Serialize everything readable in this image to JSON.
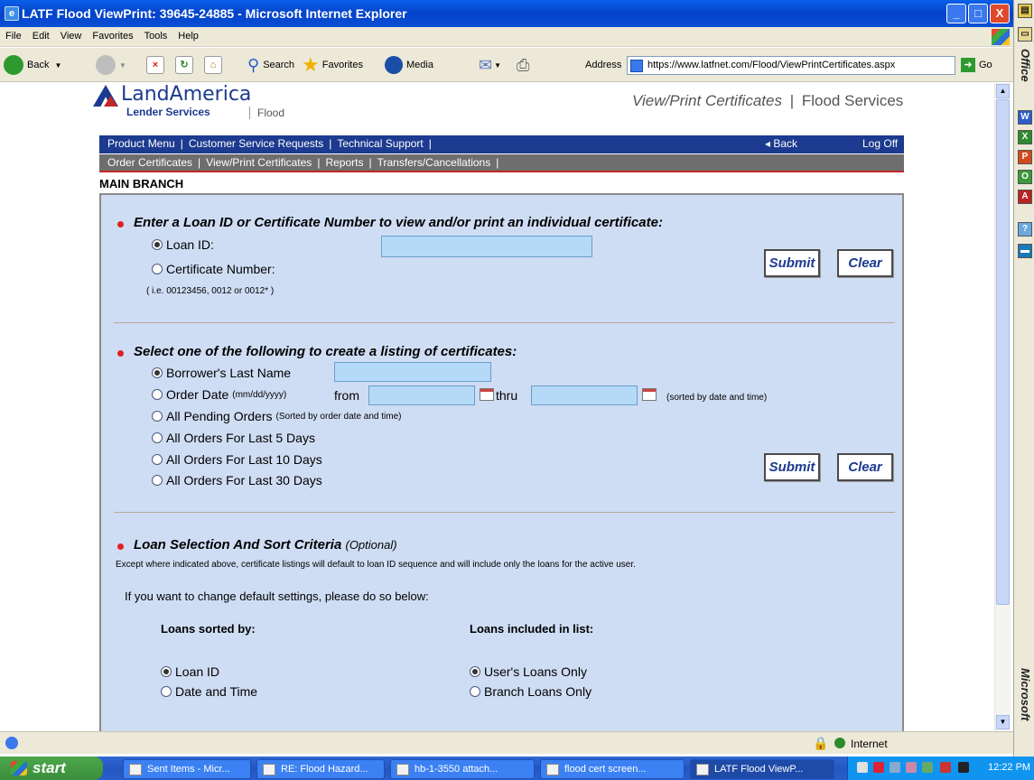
{
  "window": {
    "title": "LATF Flood ViewPrint: 39645-24885 - Microsoft Internet Explorer",
    "minimize": "_",
    "maximize": "□",
    "close": "X"
  },
  "menubar": [
    "File",
    "Edit",
    "View",
    "Favorites",
    "Tools",
    "Help"
  ],
  "toolbar": {
    "back": "Back",
    "search": "Search",
    "favorites": "Favorites",
    "media": "Media",
    "address_label": "Address",
    "address_url": "https://www.latfnet.com/Flood/ViewPrintCertificates.aspx",
    "go": "Go"
  },
  "header": {
    "brand": "LandAmerica",
    "sub_brand": "Lender Services",
    "product": "Flood",
    "page_title": "View/Print Certificates",
    "sep": "|",
    "section": "Flood Services"
  },
  "nav_primary": {
    "items": [
      "Product Menu",
      "Customer Service Requests",
      "Technical Support"
    ],
    "back": "◂ Back",
    "logoff": "Log Off"
  },
  "nav_secondary": {
    "items": [
      "Order Certificates",
      "View/Print Certificates",
      "Reports",
      "Transfers/Cancellations"
    ]
  },
  "branch": "MAIN BRANCH",
  "section1": {
    "heading": "Enter a Loan ID or Certificate Number to view and/or print an individual certificate:",
    "opt_loan": "Loan ID:",
    "opt_cert": "Certificate Number:",
    "example": "( i.e. 00123456, 0012 or 0012* )",
    "input_value": "",
    "submit": "Submit",
    "clear": "Clear"
  },
  "section2": {
    "heading": "Select one of the following to create a listing of certificates:",
    "opt_borrower": "Borrower's Last Name",
    "opt_order_date": "Order Date",
    "order_date_fmt": "(mm/dd/yyyy)",
    "from": "from",
    "thru": "thru",
    "sorted_note": "(sorted by date and time)",
    "opt_pending": "All Pending Orders",
    "pending_note": "(Sorted by order date and time)",
    "opt_5": "All Orders For Last 5 Days",
    "opt_10": "All Orders For Last 10 Days",
    "opt_30": "All Orders For Last 30 Days",
    "submit": "Submit",
    "clear": "Clear"
  },
  "section3": {
    "heading": "Loan Selection And Sort Criteria",
    "optional": "(Optional)",
    "desc": "Except where indicated above, certificate listings will default to loan ID sequence and will include only the loans for the active user.",
    "change": "If you want to change default settings, please do so below:",
    "sorted_by": "Loans sorted by:",
    "included": "Loans included in list:",
    "sort_loan": "Loan ID",
    "sort_date": "Date and Time",
    "inc_user": "User's Loans Only",
    "inc_branch": "Branch Loans Only"
  },
  "statusbar": {
    "zone": "Internet"
  },
  "taskbar": {
    "start": "start",
    "tasks": [
      "Sent Items - Micr...",
      "RE: Flood Hazard...",
      "hb-1-3550 attach...",
      "flood cert screen...",
      "LATF Flood ViewP..."
    ],
    "clock": "12:22 PM"
  },
  "officebar": {
    "label_top": "Office",
    "label_bottom": "Microsoft"
  },
  "colors": {
    "navy": "#1c3a8f",
    "panel": "#cfddf4",
    "input": "#b4daf8",
    "bullet": "#e02020"
  }
}
